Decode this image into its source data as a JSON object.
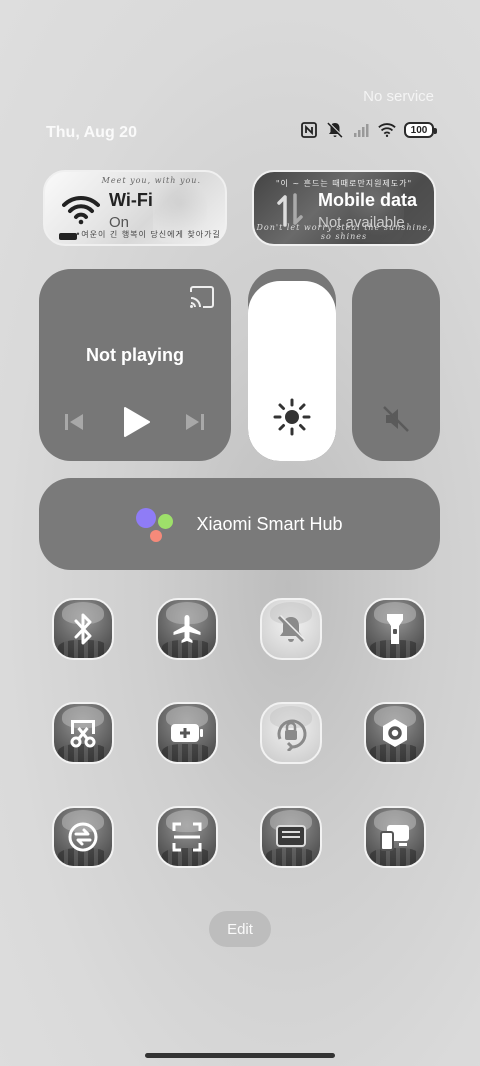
{
  "status_bar": {
    "carrier_text": "No service",
    "date": "Thu, Aug 20",
    "battery": "100",
    "icons": [
      "nfc-icon",
      "silent-icon",
      "signal-icon",
      "wifi-icon",
      "battery-icon"
    ]
  },
  "network": {
    "wifi": {
      "title": "Wi-Fi",
      "status": "On",
      "deco_top": "Meet you, with you.",
      "deco_bottom": "•여운이 긴 행복이 당신에게 찾아가길."
    },
    "mobile_data": {
      "title": "Mobile data",
      "status": "Not available",
      "deco_top": "\"이 ~ 흔드는 때때로만지원제도가\"",
      "deco_bottom": "Don't let worry steal the sunshine, so shines"
    }
  },
  "media": {
    "status": "Not playing",
    "icons": [
      "cast-icon",
      "previous-icon",
      "play-icon",
      "next-icon"
    ]
  },
  "sliders": {
    "brightness_level": 0.94,
    "volume_level": 0.0
  },
  "smart_hub": {
    "label": "Xiaomi Smart Hub",
    "colors": [
      "#8f7cf6",
      "#9ee06a",
      "#f58a7a"
    ]
  },
  "toggles": [
    {
      "name": "bluetooth",
      "icon": "bluetooth-icon",
      "active": false
    },
    {
      "name": "airplane-mode",
      "icon": "airplane-icon",
      "active": false
    },
    {
      "name": "silent-mode",
      "icon": "bell-off-icon",
      "active": true
    },
    {
      "name": "flashlight",
      "icon": "flashlight-icon",
      "active": false
    },
    {
      "name": "screenshot",
      "icon": "scissors-icon",
      "active": false
    },
    {
      "name": "battery-saver",
      "icon": "battery-plus-icon",
      "active": false
    },
    {
      "name": "rotation-lock",
      "icon": "rotation-lock-icon",
      "active": true
    },
    {
      "name": "settings",
      "icon": "hexagon-settings-icon",
      "active": false
    },
    {
      "name": "data-saver",
      "icon": "sync-icon",
      "active": false
    },
    {
      "name": "scanner",
      "icon": "scan-icon",
      "active": false
    },
    {
      "name": "screen-recorder",
      "icon": "recorder-icon",
      "active": false
    },
    {
      "name": "cast",
      "icon": "devices-icon",
      "active": false
    }
  ],
  "edit": {
    "label": "Edit"
  }
}
